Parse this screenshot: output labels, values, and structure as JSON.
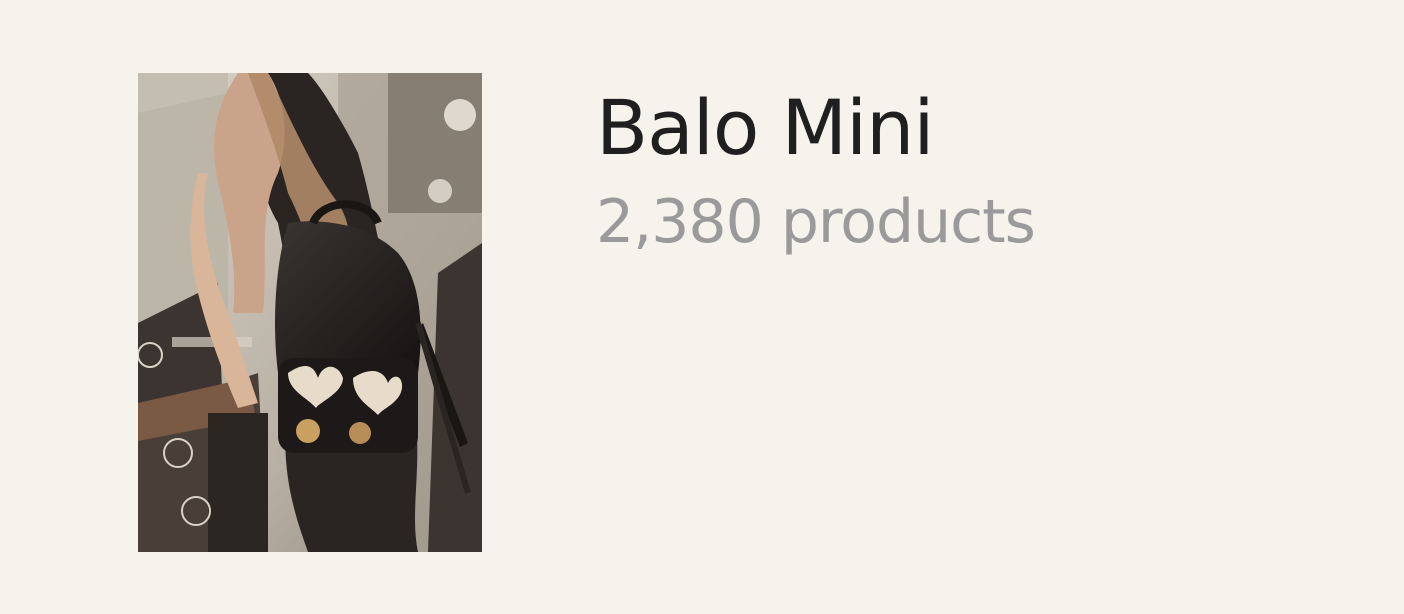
{
  "category": {
    "name": "Balo Mini",
    "product_count": "2,380 products"
  },
  "colors": {
    "background": "#f6f2ec",
    "title": "#1f1f1f",
    "subtitle": "#9a9a9a"
  },
  "image": {
    "subject": "woman-carrying-black-mini-backpack"
  }
}
